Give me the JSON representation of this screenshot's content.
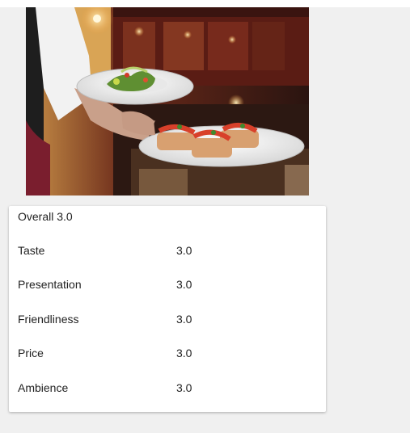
{
  "hero_image": {
    "alt": "Waiter carrying plates of salad and bruschetta in a restaurant"
  },
  "rating_card": {
    "overall_label": "Overall 3.0",
    "rows": [
      {
        "label": "Taste",
        "value": "3.0"
      },
      {
        "label": "Presentation",
        "value": "3.0"
      },
      {
        "label": "Friendliness",
        "value": "3.0"
      },
      {
        "label": "Price",
        "value": "3.0"
      },
      {
        "label": "Ambience",
        "value": "3.0"
      }
    ]
  }
}
